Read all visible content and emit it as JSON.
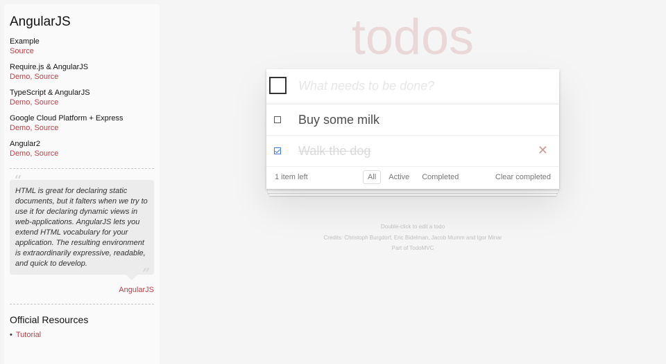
{
  "sidebar": {
    "title": "AngularJS",
    "examples": [
      {
        "name": "Example",
        "links": [
          "Source"
        ]
      },
      {
        "name": "Require.js & AngularJS",
        "links": [
          "Demo",
          "Source"
        ]
      },
      {
        "name": "TypeScript & AngularJS",
        "links": [
          "Demo",
          "Source"
        ]
      },
      {
        "name": "Google Cloud Platform + Express",
        "links": [
          "Demo",
          "Source"
        ]
      },
      {
        "name": "Angular2",
        "links": [
          "Demo",
          "Source"
        ]
      }
    ],
    "quote": {
      "open_mark": "“",
      "close_mark": "”",
      "text": "HTML is great for declaring static documents, but it falters when we try to use it for declaring dynamic views in web-applications. AngularJS lets you extend HTML vocabulary for your application. The resulting environment is extraordinarily expressive, readable, and quick to develop.",
      "source": "AngularJS"
    },
    "resources_title": "Official Resources",
    "resources": [
      "Tutorial"
    ]
  },
  "app": {
    "title": "todos",
    "new_todo_placeholder": "What needs to be done?",
    "items": [
      {
        "label": "Buy some milk",
        "completed": false
      },
      {
        "label": "Walk the dog",
        "completed": true
      }
    ],
    "destroy_glyph": "✕",
    "count_text": "1 item left",
    "filters": [
      {
        "label": "All",
        "selected": true
      },
      {
        "label": "Active",
        "selected": false
      },
      {
        "label": "Completed",
        "selected": false
      }
    ],
    "clear_completed": "Clear completed"
  },
  "info": {
    "edit_hint": "Double-click to edit a todo",
    "credits": "Credits: Christoph Burgdorf, Eric Bidelman, Jacob Mumm and Igor Minar",
    "part_of": "Part of TodoMVC"
  },
  "colors": {
    "accent": "#b83f45",
    "title": "#eaD7D7",
    "background": "#f5f5f5"
  }
}
